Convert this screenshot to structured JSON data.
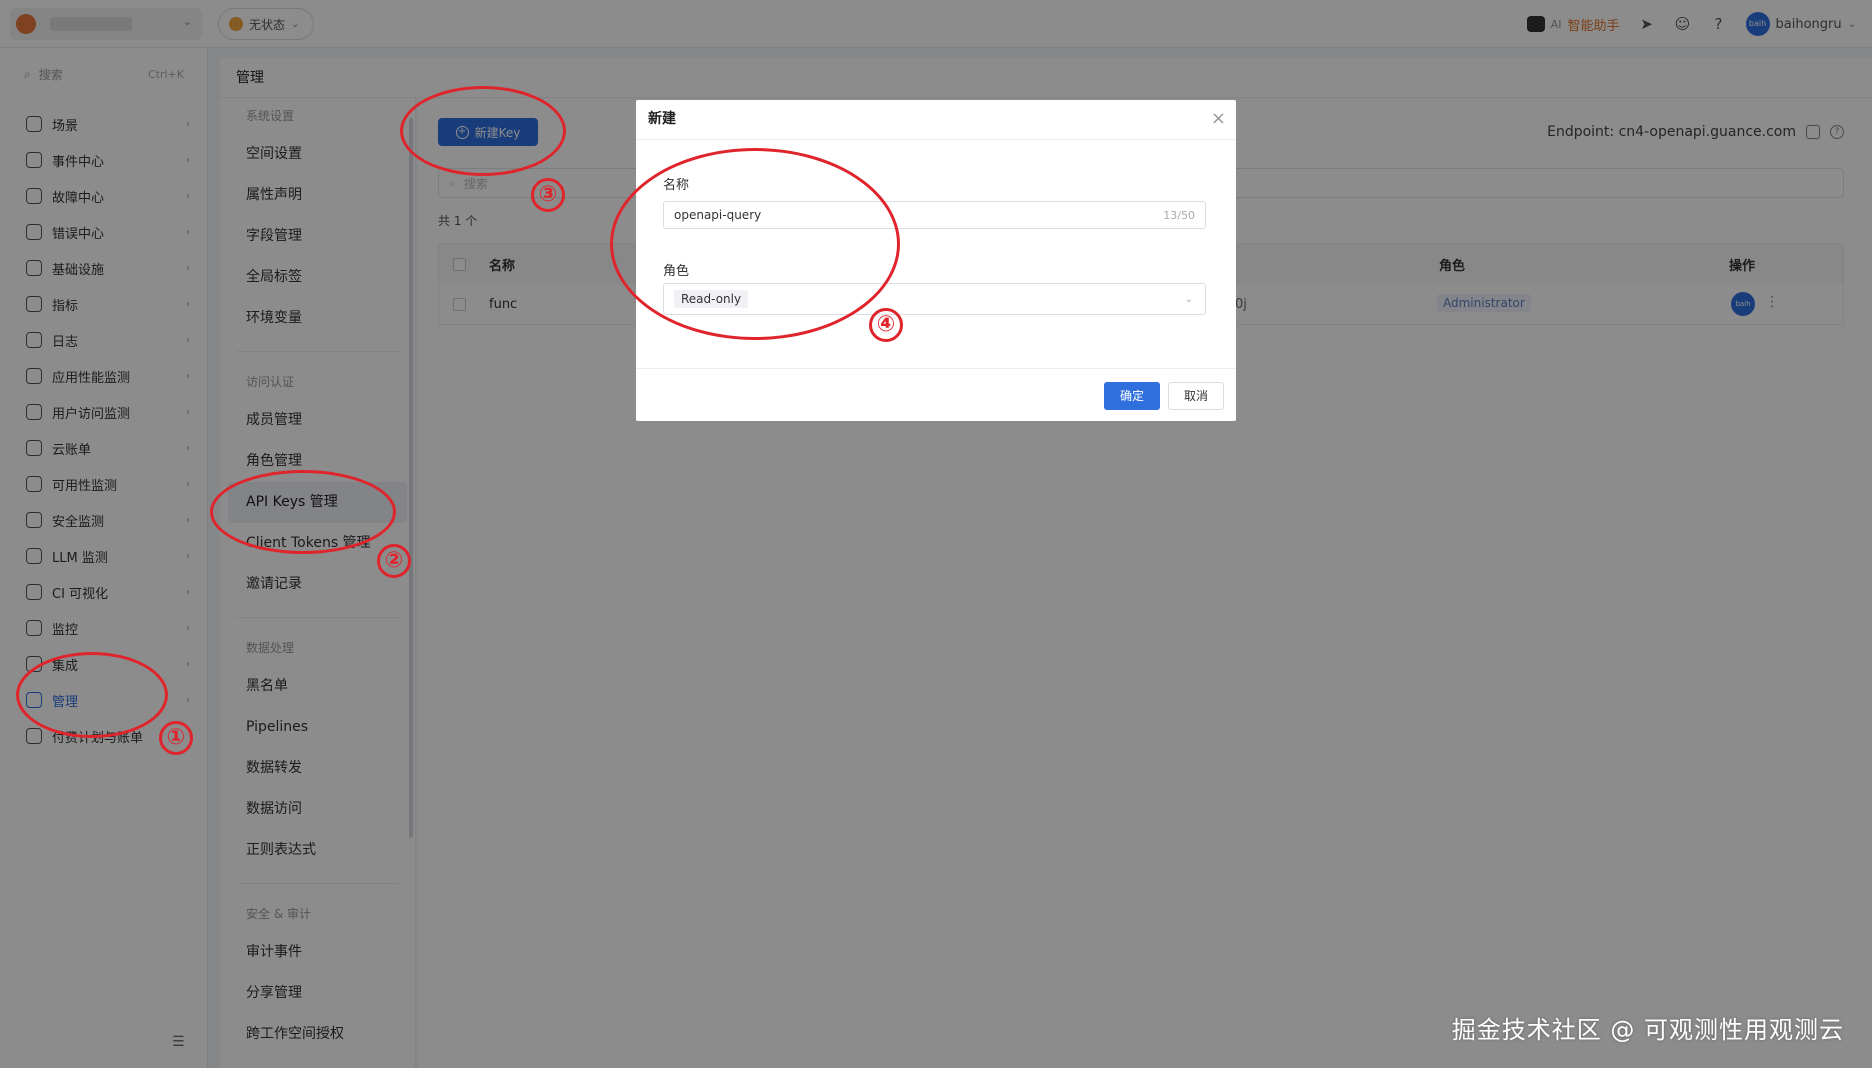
{
  "topbar": {
    "status_label": "无状态",
    "ai_label": "AI",
    "ai_text": "智能助手",
    "username": "baihongru",
    "avatar_text": "baih"
  },
  "search": {
    "placeholder": "搜索",
    "shortcut": "Ctrl+K"
  },
  "nav": {
    "items": [
      {
        "label": "场景"
      },
      {
        "label": "事件中心"
      },
      {
        "label": "故障中心"
      },
      {
        "label": "错误中心"
      },
      {
        "label": "基础设施"
      },
      {
        "label": "指标"
      },
      {
        "label": "日志"
      },
      {
        "label": "应用性能监测"
      },
      {
        "label": "用户访问监测"
      },
      {
        "label": "云账单"
      },
      {
        "label": "可用性监测"
      },
      {
        "label": "安全监测"
      },
      {
        "label": "LLM 监测"
      },
      {
        "label": "CI 可视化"
      },
      {
        "label": "监控"
      },
      {
        "label": "集成"
      },
      {
        "label": "管理"
      },
      {
        "label": "付费计划与账单"
      }
    ]
  },
  "subheader": {
    "title": "管理"
  },
  "submenu": {
    "groups": [
      {
        "title": "系统设置",
        "items": [
          "空间设置",
          "属性声明",
          "字段管理",
          "全局标签",
          "环境变量"
        ]
      },
      {
        "title": "访问认证",
        "items": [
          "成员管理",
          "角色管理",
          "API Keys 管理",
          "Client Tokens 管理",
          "邀请记录"
        ]
      },
      {
        "title": "数据处理",
        "items": [
          "黑名单",
          "Pipelines",
          "数据转发",
          "数据访问",
          "正则表达式"
        ]
      },
      {
        "title": "安全 & 审计",
        "items": [
          "审计事件",
          "分享管理",
          "跨工作空间授权"
        ]
      }
    ]
  },
  "main": {
    "new_key_label": "新建Key",
    "endpoint": "Endpoint: cn4-openapi.guance.com",
    "search_placeholder": "搜索",
    "total": "共 1 个",
    "columns": {
      "name": "名称",
      "role": "角色",
      "op": "操作"
    },
    "rows": [
      {
        "name": "func",
        "frag": "0j",
        "role": "Administrator",
        "avatar": "baih"
      }
    ]
  },
  "modal": {
    "title": "新建",
    "name_label": "名称",
    "name_value": "openapi-query",
    "name_count": "13/50",
    "role_label": "角色",
    "role_value": "Read-only",
    "ok_label": "确定",
    "cancel_label": "取消"
  },
  "annotations": [
    "①",
    "②",
    "③",
    "④"
  ],
  "watermark": "掘金技术社区 @ 可观测性用观测云",
  "colors": {
    "accent": "#2f6fde",
    "annotation": "#e0242c"
  }
}
